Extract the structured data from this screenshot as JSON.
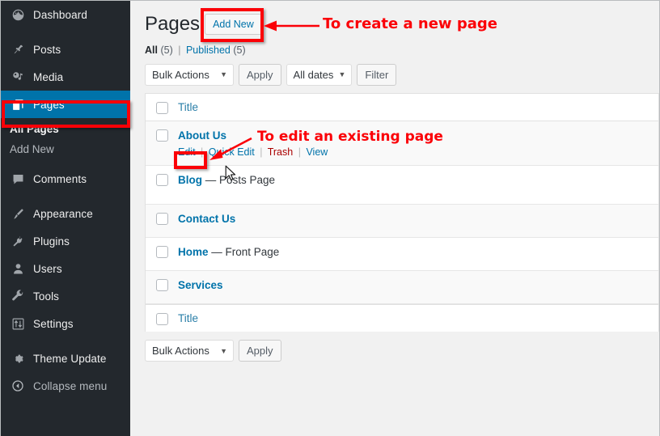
{
  "sidebar": {
    "items": [
      {
        "label": "Dashboard",
        "icon": "dashboard-icon",
        "name": "dashboard"
      },
      {
        "label": "Posts",
        "icon": "pin-icon",
        "name": "posts"
      },
      {
        "label": "Media",
        "icon": "media-icon",
        "name": "media"
      },
      {
        "label": "Pages",
        "icon": "pages-icon",
        "name": "pages",
        "current": true
      },
      {
        "label": "Comments",
        "icon": "comment-icon",
        "name": "comments"
      },
      {
        "label": "Appearance",
        "icon": "brush-icon",
        "name": "appearance"
      },
      {
        "label": "Plugins",
        "icon": "plug-icon",
        "name": "plugins"
      },
      {
        "label": "Users",
        "icon": "user-icon",
        "name": "users"
      },
      {
        "label": "Tools",
        "icon": "wrench-icon",
        "name": "tools"
      },
      {
        "label": "Settings",
        "icon": "sliders-icon",
        "name": "settings"
      },
      {
        "label": "Theme Update",
        "icon": "gear-icon",
        "name": "theme-update"
      }
    ],
    "submenu": [
      {
        "label": "All Pages",
        "active": true
      },
      {
        "label": "Add New",
        "active": false
      }
    ],
    "collapse": {
      "label": "Collapse menu",
      "icon": "collapse-icon"
    },
    "colors": {
      "background": "#23282d",
      "current": "#0073aa",
      "text": "#eeeeee"
    }
  },
  "header": {
    "title": "Pages",
    "add_new_label": "Add New"
  },
  "views": {
    "all_label": "All",
    "all_count": "(5)",
    "divider": "|",
    "published_label": "Published",
    "published_count": "(5)"
  },
  "tablenav_top": {
    "bulk_actions_label": "Bulk Actions",
    "apply_label": "Apply",
    "dates_label": "All dates",
    "filter_label": "Filter",
    "caret": "▼"
  },
  "tablenav_bottom": {
    "bulk_actions_label": "Bulk Actions",
    "apply_label": "Apply",
    "caret": "▼"
  },
  "table": {
    "column_header": "Title",
    "column_footer": "Title",
    "rows": [
      {
        "title": "About Us",
        "suffix": "",
        "actions": [
          {
            "label": "Edit",
            "type": "edit"
          },
          {
            "label": "Quick Edit",
            "type": "quickedit"
          },
          {
            "label": "Trash",
            "type": "trash"
          },
          {
            "label": "View",
            "type": "view"
          }
        ],
        "separator": "|"
      },
      {
        "title": "Blog",
        "suffix": " — Posts Page",
        "actions": []
      },
      {
        "title": "Contact Us",
        "suffix": "",
        "actions": []
      },
      {
        "title": "Home",
        "suffix": " — Front Page",
        "actions": []
      },
      {
        "title": "Services",
        "suffix": "",
        "actions": []
      }
    ]
  },
  "annotations": {
    "color": "#fb0007",
    "create_page_text": "To create a new page",
    "edit_page_text": "To edit an existing page"
  }
}
